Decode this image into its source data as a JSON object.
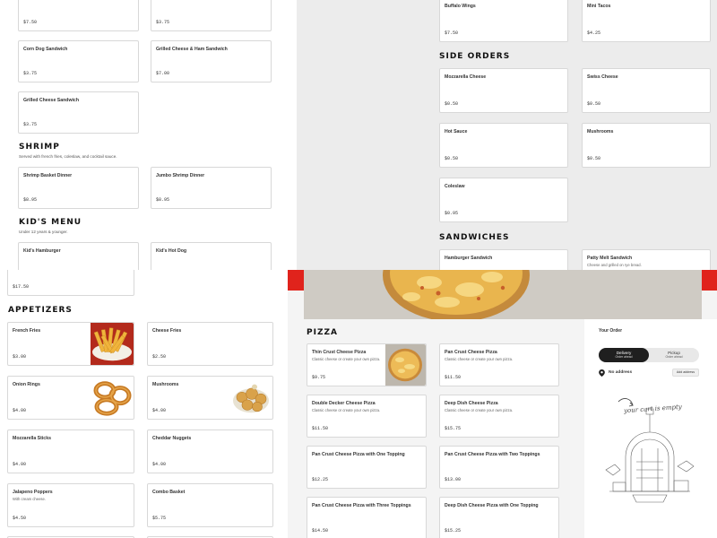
{
  "panel_top_left": {
    "cards": [
      {
        "name": "",
        "price": "$7.50"
      },
      {
        "name": "",
        "price": "$3.75"
      },
      {
        "name": "Corn Dog Sandwich",
        "price": "$3.75"
      },
      {
        "name": "Grilled Cheese & Ham Sandwich",
        "price": "$7.00"
      },
      {
        "name": "Grilled Cheese Sandwich",
        "price": "$3.75"
      }
    ],
    "shrimp": {
      "title": "SHRIMP",
      "subtitle": "Served with french fries, coleslaw, and cocktail sauce.",
      "items": [
        {
          "name": "Shrimp Basket Dinner",
          "price": "$8.95"
        },
        {
          "name": "Jumbo Shrimp Dinner",
          "price": "$8.95"
        }
      ]
    },
    "kids": {
      "title": "KID'S MENU",
      "subtitle": "Under 12 years & younger.",
      "items": [
        {
          "name": "Kid's Hamburger"
        },
        {
          "name": "Kid's Hot Dog"
        }
      ]
    }
  },
  "panel_top_right": {
    "top_items": [
      {
        "name": "Buffalo Wings",
        "price": "$7.50"
      },
      {
        "name": "Mini Tacos",
        "price": "$4.25"
      }
    ],
    "side_orders": {
      "title": "SIDE ORDERS",
      "items": [
        {
          "name": "Mozzarella Cheese",
          "price": "$0.50"
        },
        {
          "name": "Swiss Cheese",
          "price": "$0.50"
        },
        {
          "name": "Hot Sauce",
          "price": "$0.50"
        },
        {
          "name": "Mushrooms",
          "price": "$0.50"
        },
        {
          "name": "Coleslaw",
          "price": "$0.95"
        }
      ]
    },
    "sandwiches": {
      "title": "SANDWICHES",
      "items": [
        {
          "name": "Hamburger Sandwich"
        },
        {
          "name": "Patty Melt Sandwich",
          "desc": "Cheese and grilled on rye bread."
        }
      ]
    }
  },
  "panel_bottom_left": {
    "top_price": "$17.50",
    "appetizers": {
      "title": "APPETIZERS",
      "items": [
        {
          "name": "French Fries",
          "price": "$3.00",
          "image": "fries"
        },
        {
          "name": "Cheese Fries",
          "price": "$2.50"
        },
        {
          "name": "Onion Rings",
          "price": "$4.00",
          "image": "onion-rings"
        },
        {
          "name": "Mushrooms",
          "price": "$4.00",
          "image": "mushrooms"
        },
        {
          "name": "Mozzarella Sticks",
          "price": "$4.00"
        },
        {
          "name": "Cheddar Nuggets",
          "price": "$4.00"
        },
        {
          "name": "Jalapeno Poppers",
          "desc": "With cream cheese.",
          "price": "$4.50"
        },
        {
          "name": "Combo Basket",
          "price": "$5.75"
        }
      ]
    }
  },
  "panel_bottom_right": {
    "pizza": {
      "title": "PIZZA",
      "items": [
        {
          "name": "Thin Crust Cheese Pizza",
          "desc": "Classic cheese or create your own pizza.",
          "price": "$9.75",
          "image": "pizza"
        },
        {
          "name": "Pan Crust Cheese Pizza",
          "desc": "Classic cheese or create your own pizza.",
          "price": "$11.50"
        },
        {
          "name": "Double Decker Cheese Pizza",
          "desc": "Classic cheese or create your own pizza.",
          "price": "$11.50"
        },
        {
          "name": "Deep Dish Cheese Pizza",
          "desc": "Classic cheese or create your own pizza.",
          "price": "$15.75"
        },
        {
          "name": "Pan Crust Cheese Pizza with One Topping",
          "price": "$12.25"
        },
        {
          "name": "Pan Crust Cheese Pizza with Two Toppings",
          "price": "$13.00"
        },
        {
          "name": "Pan Crust Cheese Pizza with Three Toppings",
          "price": "$14.50"
        },
        {
          "name": "Deep Dish Cheese Pizza with One Topping",
          "price": "$15.25"
        }
      ]
    },
    "cart": {
      "title": "Your Order",
      "delivery_label": "Delivery",
      "delivery_sub": "Order ahead",
      "pickup_label": "Pickup",
      "pickup_sub": "Order ahead",
      "address_text": "No address",
      "add_address_button": "Add address",
      "empty_text": "your cart is empty"
    }
  },
  "colors": {
    "accent_red": "#e0231c",
    "toggle_active": "#1f1f1f"
  }
}
